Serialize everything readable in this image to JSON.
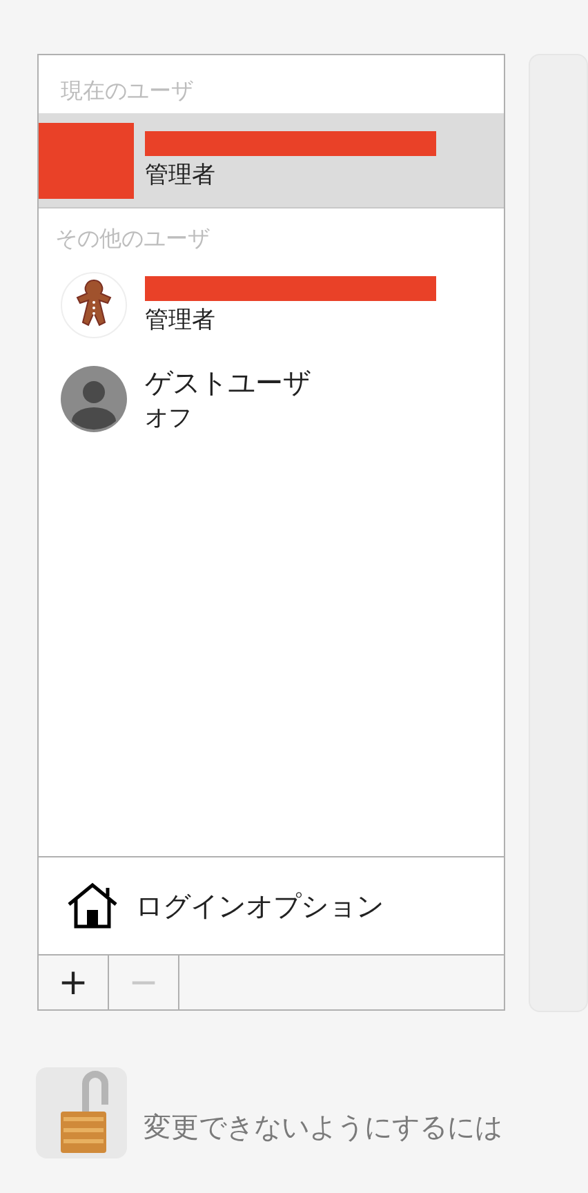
{
  "sections": [
    {
      "heading": "現在のユーザ",
      "users": [
        {
          "kind": "redacted",
          "name_redacted": true,
          "role": "管理者",
          "selected": true
        }
      ]
    },
    {
      "heading": "その他のユーザ",
      "users": [
        {
          "kind": "gingerbread",
          "name_redacted": true,
          "role": "管理者",
          "selected": false
        },
        {
          "kind": "silhouette",
          "name": "ゲストユーザ",
          "role": "オフ",
          "selected": false
        }
      ]
    }
  ],
  "login_options": "ログインオプション",
  "buttons": [
    {
      "label": "+",
      "disabled": false
    },
    {
      "label": "−",
      "disabled": true
    }
  ],
  "lock_text": "変更できないようにするには"
}
